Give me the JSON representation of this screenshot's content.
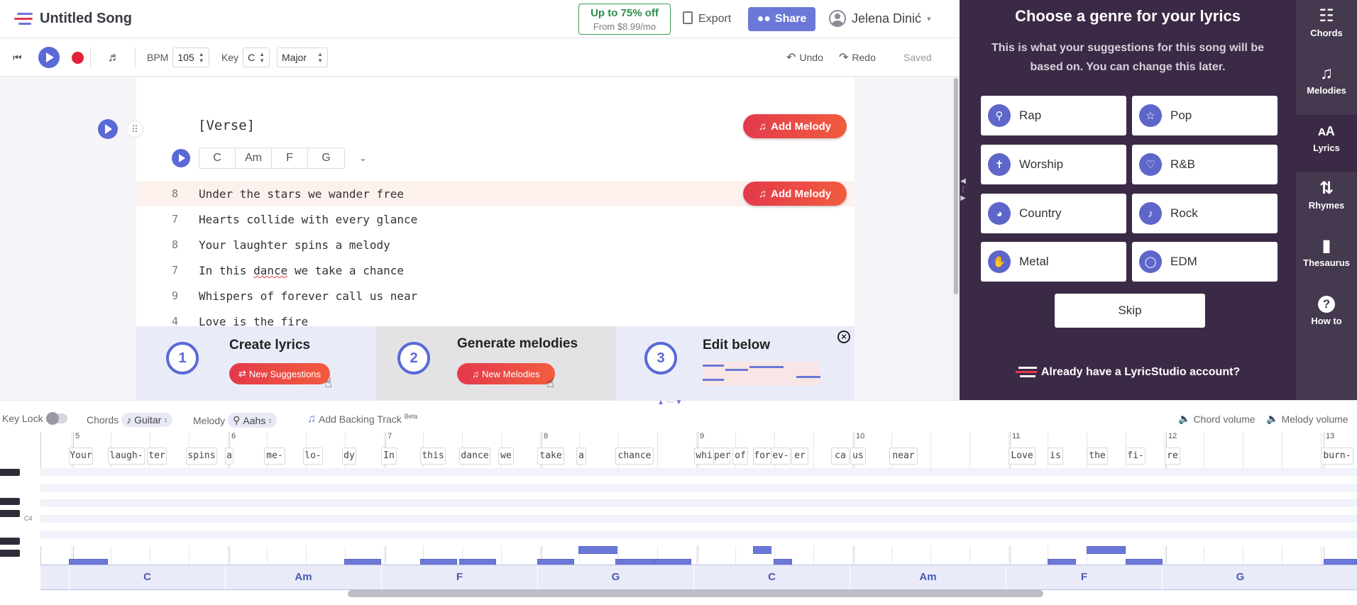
{
  "header": {
    "title": "Untitled Song",
    "promo_line1": "Up to 75% off",
    "promo_line2": "From $8.99/mo",
    "export_label": "Export",
    "share_label": "Share",
    "user_name": "Jelena Dinić"
  },
  "toolbar": {
    "bpm_label": "BPM",
    "bpm_value": "105",
    "key_label": "Key",
    "key_value": "C",
    "mode_value": "Major",
    "undo_label": "Undo",
    "redo_label": "Redo",
    "status": "Saved"
  },
  "editor": {
    "section_label": "[Verse]",
    "add_melody_label": "Add Melody",
    "chords": [
      "C",
      "Am",
      "F",
      "G"
    ],
    "lines": [
      {
        "syllables": "8",
        "text": "Under the stars we wander free"
      },
      {
        "syllables": "7",
        "text": "Hearts collide with every glance"
      },
      {
        "syllables": "8",
        "text": "Your laughter spins a melody"
      },
      {
        "syllables": "7",
        "text_before": "In this ",
        "text_flag": "dance",
        "text_after": " we take a chance"
      },
      {
        "syllables": "9",
        "text": "Whispers of forever call us near"
      },
      {
        "syllables": "4",
        "text": "Love is the fire"
      }
    ]
  },
  "onboarding": {
    "step1": {
      "num": "1",
      "title": "Create lyrics",
      "button": "New Suggestions"
    },
    "step2": {
      "num": "2",
      "title": "Generate melodies",
      "button": "New Melodies"
    },
    "step3": {
      "num": "3",
      "title": "Edit below"
    }
  },
  "genre_panel": {
    "heading": "Choose a genre for your lyrics",
    "subtitle": "This is what your suggestions for this song will be based on. You can change this later.",
    "genres": [
      "Rap",
      "Pop",
      "Worship",
      "R&B",
      "Country",
      "Rock",
      "Metal",
      "EDM"
    ],
    "skip_label": "Skip",
    "account_label": "Already have a LyricStudio account?"
  },
  "right_sidebar": [
    "Chords",
    "Melodies",
    "Lyrics",
    "Rhymes",
    "Thesaurus",
    "How to"
  ],
  "bottom_controls": {
    "key_lock": "Key Lock",
    "chords_label": "Chords",
    "chords_instrument": "Guitar",
    "melody_label": "Melody",
    "melody_instrument": "Aahs",
    "backing_track": "Add Backing Track",
    "beta": "Beta",
    "chord_volume": "Chord volume",
    "melody_volume": "Melody volume"
  },
  "piano_roll": {
    "c4_label": "C4",
    "measures": [
      "5",
      "6",
      "7",
      "8",
      "9",
      "10",
      "11",
      "12",
      "13"
    ],
    "words": [
      "Your",
      "laugh-",
      "ter",
      "spins",
      "a",
      "me-",
      "lo-",
      "dy",
      "In",
      "this",
      "dance",
      "we",
      "take",
      "a",
      "chance",
      "whi",
      "per",
      "of",
      "for",
      "ev-",
      "er",
      "ca",
      "us",
      "near",
      "Love",
      "is",
      "the",
      "fi-",
      "re",
      "burn-"
    ],
    "chord_bar": [
      "C",
      "Am",
      "F",
      "G",
      "C",
      "Am",
      "F",
      "G"
    ]
  },
  "colors": {
    "accent": "#5a69d6",
    "panel_bg": "#3b2a45",
    "add_melody": "#e33a4c",
    "promo_green": "#2d8c4a"
  }
}
